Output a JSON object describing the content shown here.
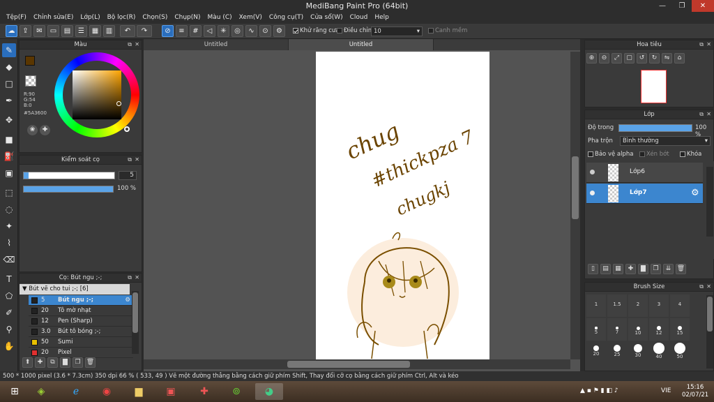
{
  "window": {
    "title": "MediBang Paint Pro (64bit)"
  },
  "menu": [
    "Tệp(F)",
    "Chỉnh sửa(E)",
    "Lớp(L)",
    "Bộ lọc(R)",
    "Chọn(S)",
    "Chụp(N)",
    "Màu (C)",
    "Xem(V)",
    "Công cụ(T)",
    "Cửa sổ(W)",
    "Cloud",
    "Help"
  ],
  "toolbar": {
    "antialias_label": "Khử răng cưa",
    "correction_label": "Điều chỉnh",
    "correction_value": "10",
    "snap_label": "Canh mềm"
  },
  "color_panel": {
    "title": "Màu",
    "rgb": {
      "r": "R:90",
      "g": "G:54",
      "b": "B:0"
    },
    "hex": "#5A3600",
    "foreground": "#5a3600"
  },
  "brush_control": {
    "title": "Kiểm soát cọ",
    "size": "5",
    "opacity": "100 %",
    "size_fraction": 0.05,
    "opacity_fraction": 1.0
  },
  "brush_list": {
    "title": "Cọ: Bút ngu ;-;",
    "group": "Bút vẽ cho tui ;-; [6]",
    "items": [
      {
        "size": "5",
        "name": "Bút ngu ;-;",
        "color": "#3c86cf"
      },
      {
        "size": "20",
        "name": "Tô mờ nhạt",
        "color": "#222222"
      },
      {
        "size": "12",
        "name": "Pen (Sharp)",
        "color": "#222222"
      },
      {
        "size": "3.0",
        "name": "Bút tô bóng ;-;",
        "color": "#222222"
      },
      {
        "size": "50",
        "name": "Sumi",
        "color": "#e8c000"
      },
      {
        "size": "20",
        "name": "Pixel",
        "color": "#e03030"
      }
    ]
  },
  "canvas": {
    "tabs": [
      "Untitled",
      "Untitled"
    ],
    "text_lines": [
      "chug",
      "#thickpza 7",
      "chugkj"
    ]
  },
  "navigator": {
    "title": "Hoa tiêu"
  },
  "layers": {
    "title": "Lớp",
    "opacity_label": "Độ trong",
    "opacity_value": "100 %",
    "opacity_fraction": 1.0,
    "blend_label": "Pha trộn",
    "blend_value": "Bình thường",
    "protect_alpha": "Bảo vệ alpha",
    "clipping": "Xén bớt",
    "lock": "Khóa",
    "items": [
      {
        "name": "Lớp6",
        "selected": false
      },
      {
        "name": "Lớp7",
        "selected": true
      }
    ]
  },
  "brush_size": {
    "title": "Brush Size",
    "labels": [
      "1",
      "1.5",
      "2",
      "3",
      "4",
      "5",
      "7",
      "10",
      "12",
      "15",
      "20",
      "25",
      "30",
      "40",
      "50"
    ]
  },
  "status": {
    "text": "500 * 1000 pixel   (3.6 * 7.3cm)   350 dpi   66 %   ( 533, 49 )   Vẽ một đường thẳng bằng cách giữ phím Shift, Thay đổi cỡ cọ bằng cách giữ phím Ctrl, Alt và kéo"
  },
  "taskbar": {
    "lang": "VIE",
    "time": "15:16",
    "date": "02/07/21"
  }
}
